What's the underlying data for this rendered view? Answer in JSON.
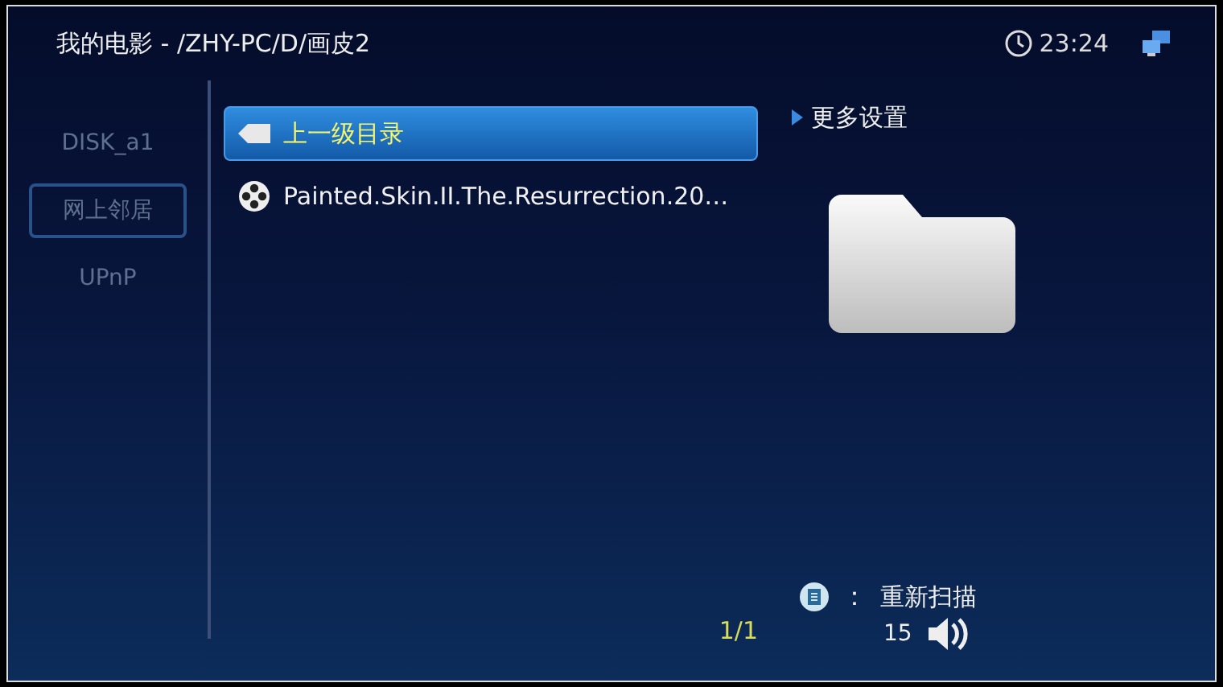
{
  "header": {
    "title": "我的电影 - /ZHY-PC/D/画皮2",
    "time": "23:24"
  },
  "sources": [
    {
      "label": "DISK_a1",
      "selected": false
    },
    {
      "label": "网上邻居",
      "selected": true
    },
    {
      "label": "UPnP",
      "selected": false
    }
  ],
  "files": [
    {
      "kind": "up",
      "label": "上一级目录",
      "selected": true
    },
    {
      "kind": "video",
      "label": "Painted.Skin.II.The.Resurrection.20…",
      "selected": false
    }
  ],
  "page": "1/1",
  "more_settings": "更多设置",
  "hint": {
    "separator": "：",
    "label": "重新扫描"
  },
  "volume": "15"
}
